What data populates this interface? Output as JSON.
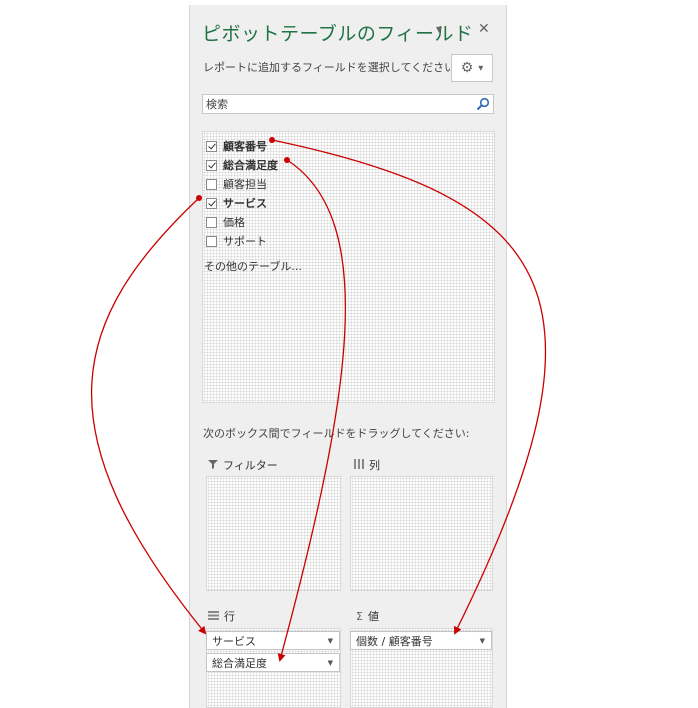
{
  "pane": {
    "title": "ピボットテーブルのフィールド",
    "dropdown_glyph": "▾",
    "close_glyph": "✕",
    "subtitle": "レポートに追加するフィールドを選択してください:",
    "gear_glyph": "⚙",
    "gear_arrow": "▾"
  },
  "search": {
    "placeholder": "検索"
  },
  "fields": [
    {
      "label": "顧客番号",
      "checked": true,
      "bold": true
    },
    {
      "label": "総合満足度",
      "checked": true,
      "bold": true
    },
    {
      "label": "顧客担当",
      "checked": false,
      "bold": false
    },
    {
      "label": "サービス",
      "checked": true,
      "bold": true
    },
    {
      "label": "価格",
      "checked": false,
      "bold": false
    },
    {
      "label": "サポート",
      "checked": false,
      "bold": false
    }
  ],
  "other_tables": "その他のテーブル...",
  "drag_instruction": "次のボックス間でフィールドをドラッグしてください:",
  "areas": {
    "filter": {
      "label": "フィルター",
      "icon": "filter-icon"
    },
    "columns": {
      "label": "列",
      "icon": "columns-icon"
    },
    "rows": {
      "label": "行",
      "icon": "rows-icon",
      "items": [
        "サービス",
        "総合満足度"
      ]
    },
    "values": {
      "label": "値",
      "icon_glyph": "Σ",
      "items": [
        "個数 / 顧客番号"
      ]
    }
  },
  "colors": {
    "accent": "#217346",
    "annotation": "#cc0000"
  }
}
